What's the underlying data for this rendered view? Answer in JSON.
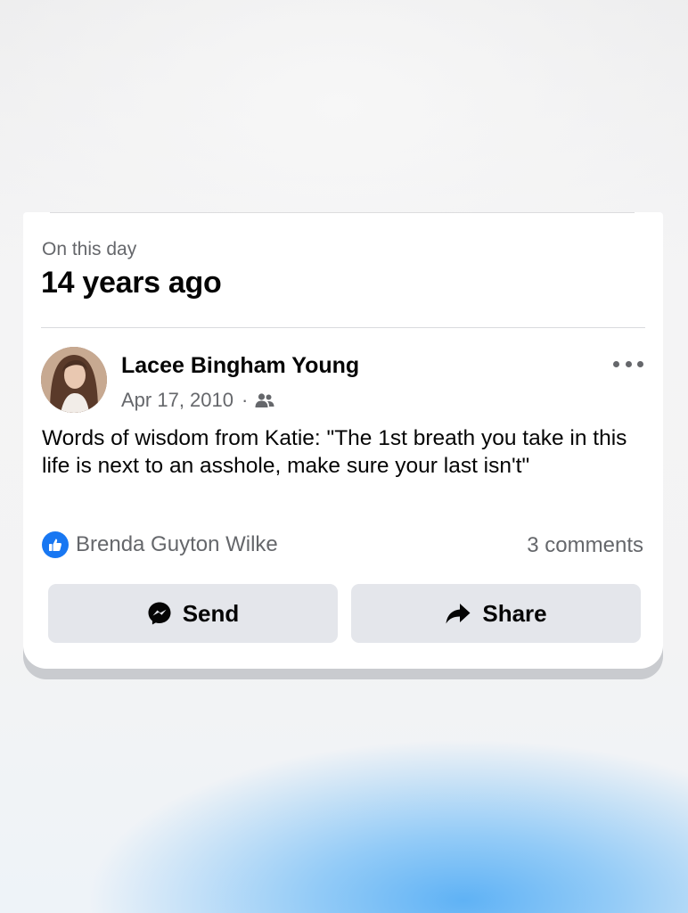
{
  "memory": {
    "eyebrow": "On this day",
    "headline": "14 years ago"
  },
  "post": {
    "author": "Lacee Bingham Young",
    "date": "Apr 17, 2010",
    "separator": "·",
    "audience_icon": "friends-icon",
    "text": "Words of wisdom from Katie: \"The 1st breath you take in this life is next to an asshole, make sure your last isn't\"",
    "reactor": "Brenda Guyton Wilke",
    "reaction_icon": "like-icon",
    "comments": "3 comments"
  },
  "actions": {
    "send_label": "Send",
    "send_icon": "messenger-icon",
    "share_label": "Share",
    "share_icon": "share-arrow-icon"
  },
  "colors": {
    "accent": "#1877f2",
    "button_bg": "#e4e6eb",
    "secondary_text": "#65676b"
  }
}
